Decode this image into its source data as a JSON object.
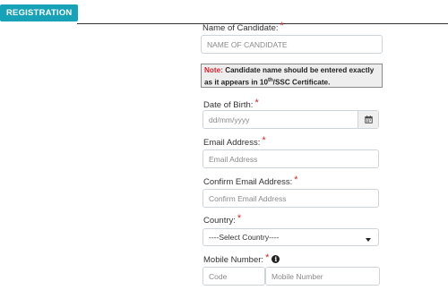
{
  "header": {
    "tab_label": "REGISTRATION"
  },
  "form": {
    "candidate_name": {
      "label": "Name of Candidate:",
      "placeholder": "NAME OF CANDIDATE"
    },
    "note": {
      "prefix": "Note:",
      "text_before_sup": "Candidate name should be entered exactly as it appears in 10",
      "sup": "th",
      "text_after_sup": "/SSC Certificate."
    },
    "dob": {
      "label": "Date of Birth:",
      "placeholder": "dd/mm/yyyy"
    },
    "email": {
      "label": "Email Address:",
      "placeholder": "Email Address"
    },
    "confirm_email": {
      "label": "Confirm Email Address:",
      "placeholder": "Confirm Email Address"
    },
    "country": {
      "label": "Country:",
      "selected": "----Select Country----"
    },
    "mobile": {
      "label": "Mobile Number:",
      "code_placeholder": "Code",
      "number_placeholder": "Mobile Number"
    },
    "required_marker": "*",
    "info_glyph": "i"
  },
  "icons": {
    "calendar": "calendar-icon",
    "dropdown": "chevron-down-icon",
    "info": "info-icon"
  },
  "colors": {
    "accent": "#17a2b8",
    "required": "#d9232d"
  }
}
